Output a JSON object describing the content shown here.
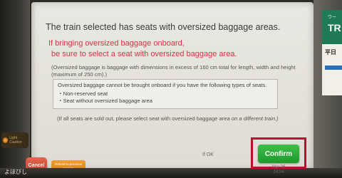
{
  "screen": {
    "title": "The train selected has seats with oversized baggage areas.",
    "warning_line1": "If bringing oversized baggage onboard,",
    "warning_line2": "be sure to select a seat with oversized baggage area.",
    "note": "(Oversized baggage is baggage with dimensions in excess of 160 cm total for length, width and height (maximum of 250 cm).)",
    "restriction": {
      "heading": "Oversized baggage cannot be brought onboard if you have the following types of seats.",
      "items": [
        "Non-reserved seat",
        "Seat without oversized baggage area"
      ]
    },
    "soldout_prefix": "(If all seats are sold out, please select seat with oversized baggage area ",
    "soldout_emphasis": "on a different train.)"
  },
  "controls": {
    "cancel_label": "Cancel",
    "refund_label": "Refund to previous screen",
    "ok_hint": "If OK",
    "confirm_label": "Confirm",
    "date": "Mar.26",
    "time": "14:04"
  },
  "kiosk": {
    "side_light_label": "Light Caution",
    "mark": "よほびし",
    "sign_top": "TR",
    "sign_sub": "ワー",
    "sign_mid": "平日"
  },
  "colors": {
    "warning": "#d6343f",
    "confirm": "#1f9a2c",
    "cancel": "#c2412c",
    "highlight_frame": "#b8102e"
  }
}
